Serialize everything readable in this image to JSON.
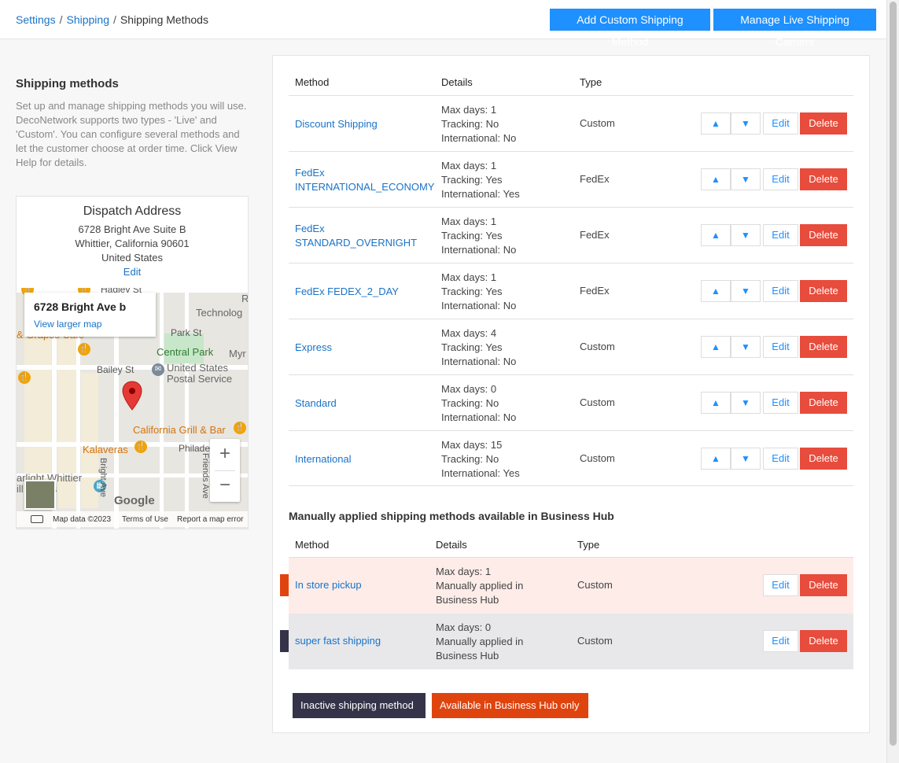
{
  "breadcrumb": {
    "items": [
      "Settings",
      "Shipping"
    ],
    "current": "Shipping Methods",
    "separator": "/"
  },
  "actions": {
    "add_custom": "Add Custom Shipping Method",
    "manage_live": "Manage Live Shipping Carriers"
  },
  "sidebar": {
    "title": "Shipping methods",
    "description": "Set up and manage shipping methods you will use. DecoNetwork supports two types - 'Live' and 'Custom'. You can configure several methods and let the customer choose at order time. Click View Help for details."
  },
  "dispatch": {
    "title": "Dispatch Address",
    "line1": "6728 Bright Ave Suite B",
    "line2": "Whittier, California 90601",
    "line3": "United States",
    "edit_label": "Edit"
  },
  "map": {
    "info_title": "6728 Bright Ave b",
    "info_link": "View larger map",
    "labels": {
      "hadley": "Hadley St",
      "technology": "Technolog",
      "park_st": "Park St",
      "central_park": "Central Park",
      "myr": "Myr",
      "bailey": "Bailey St",
      "usps1": "United States",
      "usps2": "Postal Service",
      "california_grill": "California Grill & Bar",
      "kalaveras": "Kalaveras",
      "philadelphia": "Philade",
      "starlight1": "arlight Whittier",
      "starlight2": "ill    nemas",
      "bright_ave": "Bright Ave",
      "friends_ave": "Friends Ave",
      "r": "R",
      "grapes": "& Grapes Cafe"
    },
    "zoom_in": "+",
    "zoom_out": "−",
    "google": "Google",
    "map_data": "Map data ©2023",
    "terms": "Terms of Use",
    "report": "Report a map error"
  },
  "table": {
    "headers": {
      "method": "Method",
      "details": "Details",
      "type": "Type"
    },
    "rows": [
      {
        "method_lines": [
          "Discount Shipping"
        ],
        "details": [
          "Max days: 1",
          "Tracking: No",
          "International: No"
        ],
        "type": "Custom"
      },
      {
        "method_lines": [
          "FedEx",
          "INTERNATIONAL_ECONOMY"
        ],
        "details": [
          "Max days: 1",
          "Tracking: Yes",
          "International: Yes"
        ],
        "type": "FedEx"
      },
      {
        "method_lines": [
          "FedEx",
          "STANDARD_OVERNIGHT"
        ],
        "details": [
          "Max days: 1",
          "Tracking: Yes",
          "International: No"
        ],
        "type": "FedEx"
      },
      {
        "method_lines": [
          "FedEx FEDEX_2_DAY"
        ],
        "details": [
          "Max days: 1",
          "Tracking: Yes",
          "International: No"
        ],
        "type": "FedEx"
      },
      {
        "method_lines": [
          "Express"
        ],
        "details": [
          "Max days: 4",
          "Tracking: Yes",
          "International: No"
        ],
        "type": "Custom"
      },
      {
        "method_lines": [
          "Standard"
        ],
        "details": [
          "Max days: 0",
          "Tracking: No",
          "International: No"
        ],
        "type": "Custom"
      },
      {
        "method_lines": [
          "International"
        ],
        "details": [
          "Max days: 15",
          "Tracking: No",
          "International: Yes"
        ],
        "type": "Custom"
      }
    ],
    "up_label": "▲",
    "down_label": "▼",
    "edit_label": "Edit",
    "delete_label": "Delete"
  },
  "manual": {
    "title": "Manually applied shipping methods available in Business Hub",
    "headers": {
      "method": "Method",
      "details": "Details",
      "type": "Type"
    },
    "rows": [
      {
        "method": "In store pickup",
        "details": [
          "Max days: 1",
          "Manually applied in",
          "Business Hub"
        ],
        "type": "Custom",
        "bg": "#fdece8",
        "marker": "#e0440e"
      },
      {
        "method": "super fast shipping",
        "details": [
          "Max days: 0",
          "Manually applied in",
          "Business Hub"
        ],
        "type": "Custom",
        "bg": "#e8e8ea",
        "marker": "#35334a"
      }
    ]
  },
  "legend": {
    "inactive": "Inactive shipping method",
    "inactive_color": "#35334a",
    "hub_only": "Available in Business Hub only",
    "hub_color": "#e0440e"
  }
}
